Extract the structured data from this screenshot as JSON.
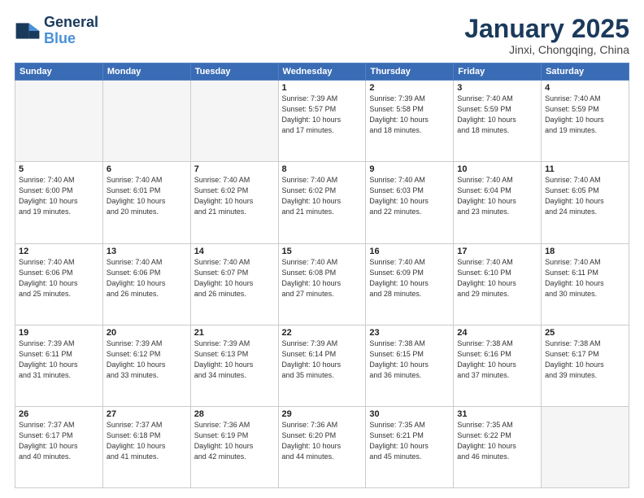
{
  "logo": {
    "line1": "General",
    "line2": "Blue"
  },
  "title": "January 2025",
  "subtitle": "Jinxi, Chongqing, China",
  "days_of_week": [
    "Sunday",
    "Monday",
    "Tuesday",
    "Wednesday",
    "Thursday",
    "Friday",
    "Saturday"
  ],
  "weeks": [
    [
      {
        "day": "",
        "info": ""
      },
      {
        "day": "",
        "info": ""
      },
      {
        "day": "",
        "info": ""
      },
      {
        "day": "1",
        "info": "Sunrise: 7:39 AM\nSunset: 5:57 PM\nDaylight: 10 hours\nand 17 minutes."
      },
      {
        "day": "2",
        "info": "Sunrise: 7:39 AM\nSunset: 5:58 PM\nDaylight: 10 hours\nand 18 minutes."
      },
      {
        "day": "3",
        "info": "Sunrise: 7:40 AM\nSunset: 5:59 PM\nDaylight: 10 hours\nand 18 minutes."
      },
      {
        "day": "4",
        "info": "Sunrise: 7:40 AM\nSunset: 5:59 PM\nDaylight: 10 hours\nand 19 minutes."
      }
    ],
    [
      {
        "day": "5",
        "info": "Sunrise: 7:40 AM\nSunset: 6:00 PM\nDaylight: 10 hours\nand 19 minutes."
      },
      {
        "day": "6",
        "info": "Sunrise: 7:40 AM\nSunset: 6:01 PM\nDaylight: 10 hours\nand 20 minutes."
      },
      {
        "day": "7",
        "info": "Sunrise: 7:40 AM\nSunset: 6:02 PM\nDaylight: 10 hours\nand 21 minutes."
      },
      {
        "day": "8",
        "info": "Sunrise: 7:40 AM\nSunset: 6:02 PM\nDaylight: 10 hours\nand 21 minutes."
      },
      {
        "day": "9",
        "info": "Sunrise: 7:40 AM\nSunset: 6:03 PM\nDaylight: 10 hours\nand 22 minutes."
      },
      {
        "day": "10",
        "info": "Sunrise: 7:40 AM\nSunset: 6:04 PM\nDaylight: 10 hours\nand 23 minutes."
      },
      {
        "day": "11",
        "info": "Sunrise: 7:40 AM\nSunset: 6:05 PM\nDaylight: 10 hours\nand 24 minutes."
      }
    ],
    [
      {
        "day": "12",
        "info": "Sunrise: 7:40 AM\nSunset: 6:06 PM\nDaylight: 10 hours\nand 25 minutes."
      },
      {
        "day": "13",
        "info": "Sunrise: 7:40 AM\nSunset: 6:06 PM\nDaylight: 10 hours\nand 26 minutes."
      },
      {
        "day": "14",
        "info": "Sunrise: 7:40 AM\nSunset: 6:07 PM\nDaylight: 10 hours\nand 26 minutes."
      },
      {
        "day": "15",
        "info": "Sunrise: 7:40 AM\nSunset: 6:08 PM\nDaylight: 10 hours\nand 27 minutes."
      },
      {
        "day": "16",
        "info": "Sunrise: 7:40 AM\nSunset: 6:09 PM\nDaylight: 10 hours\nand 28 minutes."
      },
      {
        "day": "17",
        "info": "Sunrise: 7:40 AM\nSunset: 6:10 PM\nDaylight: 10 hours\nand 29 minutes."
      },
      {
        "day": "18",
        "info": "Sunrise: 7:40 AM\nSunset: 6:11 PM\nDaylight: 10 hours\nand 30 minutes."
      }
    ],
    [
      {
        "day": "19",
        "info": "Sunrise: 7:39 AM\nSunset: 6:11 PM\nDaylight: 10 hours\nand 31 minutes."
      },
      {
        "day": "20",
        "info": "Sunrise: 7:39 AM\nSunset: 6:12 PM\nDaylight: 10 hours\nand 33 minutes."
      },
      {
        "day": "21",
        "info": "Sunrise: 7:39 AM\nSunset: 6:13 PM\nDaylight: 10 hours\nand 34 minutes."
      },
      {
        "day": "22",
        "info": "Sunrise: 7:39 AM\nSunset: 6:14 PM\nDaylight: 10 hours\nand 35 minutes."
      },
      {
        "day": "23",
        "info": "Sunrise: 7:38 AM\nSunset: 6:15 PM\nDaylight: 10 hours\nand 36 minutes."
      },
      {
        "day": "24",
        "info": "Sunrise: 7:38 AM\nSunset: 6:16 PM\nDaylight: 10 hours\nand 37 minutes."
      },
      {
        "day": "25",
        "info": "Sunrise: 7:38 AM\nSunset: 6:17 PM\nDaylight: 10 hours\nand 39 minutes."
      }
    ],
    [
      {
        "day": "26",
        "info": "Sunrise: 7:37 AM\nSunset: 6:17 PM\nDaylight: 10 hours\nand 40 minutes."
      },
      {
        "day": "27",
        "info": "Sunrise: 7:37 AM\nSunset: 6:18 PM\nDaylight: 10 hours\nand 41 minutes."
      },
      {
        "day": "28",
        "info": "Sunrise: 7:36 AM\nSunset: 6:19 PM\nDaylight: 10 hours\nand 42 minutes."
      },
      {
        "day": "29",
        "info": "Sunrise: 7:36 AM\nSunset: 6:20 PM\nDaylight: 10 hours\nand 44 minutes."
      },
      {
        "day": "30",
        "info": "Sunrise: 7:35 AM\nSunset: 6:21 PM\nDaylight: 10 hours\nand 45 minutes."
      },
      {
        "day": "31",
        "info": "Sunrise: 7:35 AM\nSunset: 6:22 PM\nDaylight: 10 hours\nand 46 minutes."
      },
      {
        "day": "",
        "info": ""
      }
    ]
  ]
}
